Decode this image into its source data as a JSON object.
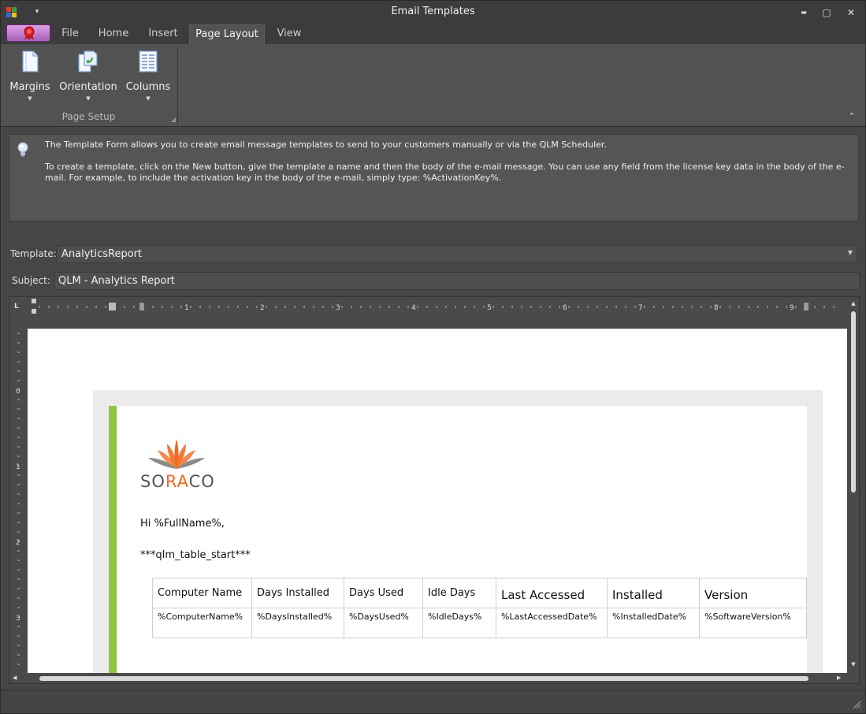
{
  "window": {
    "title": "Email Templates",
    "minimize_glyph": "▬",
    "maximize_glyph": "▢",
    "close_glyph": "✕",
    "qat_glyph": "▾"
  },
  "ribbon": {
    "tabs": [
      {
        "label": "File"
      },
      {
        "label": "Home"
      },
      {
        "label": "Insert"
      },
      {
        "label": "Page Layout",
        "active": true
      },
      {
        "label": "View"
      }
    ],
    "buttons": {
      "margins": "Margins",
      "orientation": "Orientation",
      "columns": "Columns"
    },
    "dropdown_glyph": "▼",
    "group_label": "Page Setup",
    "collapse_glyph": "⌃"
  },
  "info": {
    "line1": "The Template Form allows you to create email message templates to send to your customers manually or via the QLM Scheduler.",
    "line2": "To create a template, click on the New button, give the template a name and then the body of the e-mail message. You can use any field from the license key data in the body of the e-mail. For example, to include the activation key in the body of the e-mail, simply type: %ActivationKey%."
  },
  "form": {
    "template_label": "Template:",
    "template_value": "AnalyticsReport",
    "subject_label": "Subject:",
    "subject_value": "QLM - Analytics Report"
  },
  "ruler": {
    "corner": "L",
    "h_numbers": [
      "1",
      "2",
      "3",
      "4",
      "5",
      "6",
      "7",
      "8",
      "9"
    ],
    "v_numbers": [
      "0",
      "1",
      "2",
      "3"
    ]
  },
  "email": {
    "logo": {
      "so": "SO",
      "ra": "RA",
      "co": "CO"
    },
    "greeting": "Hi %FullName%,",
    "table_start": "***qlm_table_start***",
    "headers": [
      "Computer Name",
      "Days Installed",
      "Days Used",
      "Idle Days",
      "Last Accessed",
      "Installed",
      "Version"
    ],
    "row": [
      "%ComputerName%",
      "%DaysInstalled%",
      "%DaysUsed%",
      "%IdleDays%",
      "%LastAccessedDate%",
      "%InstalledDate%",
      "%SoftwareVersion%"
    ]
  },
  "colors": {
    "accent_green": "#8dc63f",
    "logo_orange": "#f26a21",
    "ribbon_bg": "#525252",
    "window_bg": "#464646"
  },
  "icons": [
    "app-icon",
    "margins-icon",
    "orientation-icon",
    "columns-icon",
    "lightbulb-icon",
    "soraco-logo",
    "resize-grip-icon"
  ]
}
